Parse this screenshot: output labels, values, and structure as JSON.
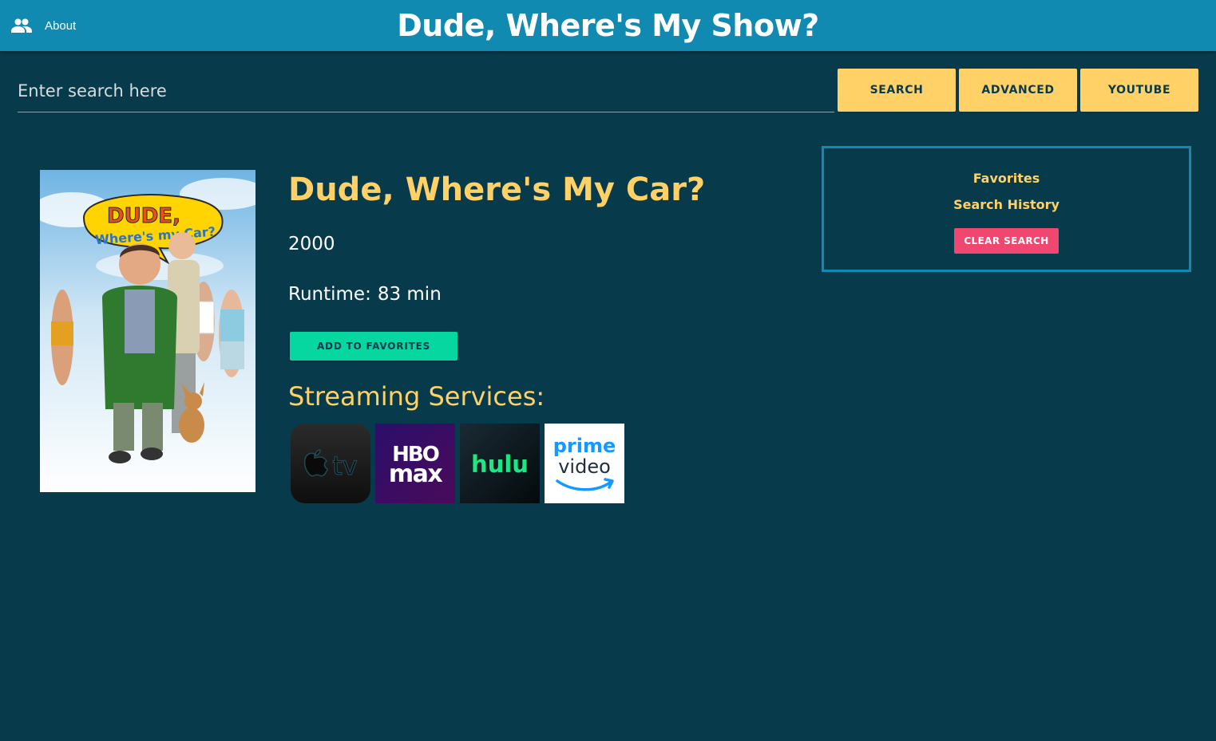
{
  "header": {
    "about_label": "About",
    "site_title": "Dude, Where's My Show?",
    "about_icon": "people-icon"
  },
  "search": {
    "placeholder": "Enter search here",
    "value": "",
    "search_label": "SEARCH",
    "advanced_label": "ADVANCED",
    "youtube_label": "YOUTUBE"
  },
  "movie": {
    "title": "Dude, Where's My Car?",
    "year": "2000",
    "runtime_label": "Runtime:",
    "runtime_value": "83 min",
    "add_favorites_label": "ADD TO FAVORITES",
    "poster_title_top": "DUDE,",
    "poster_title_bottom": "Where's my Car?"
  },
  "streaming": {
    "heading": "Streaming Services:",
    "services": [
      {
        "name": "Apple TV",
        "logo_text": "tv",
        "icon": "apple-tv-logo"
      },
      {
        "name": "HBO Max",
        "logo_top": "HBO",
        "logo_bottom": "max",
        "icon": "hbo-max-logo"
      },
      {
        "name": "Hulu",
        "logo_text": "hulu",
        "icon": "hulu-logo"
      },
      {
        "name": "Prime Video",
        "logo_top": "prime",
        "logo_bottom": "video",
        "icon": "prime-video-logo"
      }
    ]
  },
  "sidebar": {
    "favorites_label": "Favorites",
    "history_label": "Search History",
    "clear_label": "CLEAR SEARCH"
  },
  "colors": {
    "background": "#073b4c",
    "header": "#118ab2",
    "accent_yellow": "#ffd166",
    "accent_green": "#06d6a0",
    "accent_pink": "#ef476f"
  }
}
